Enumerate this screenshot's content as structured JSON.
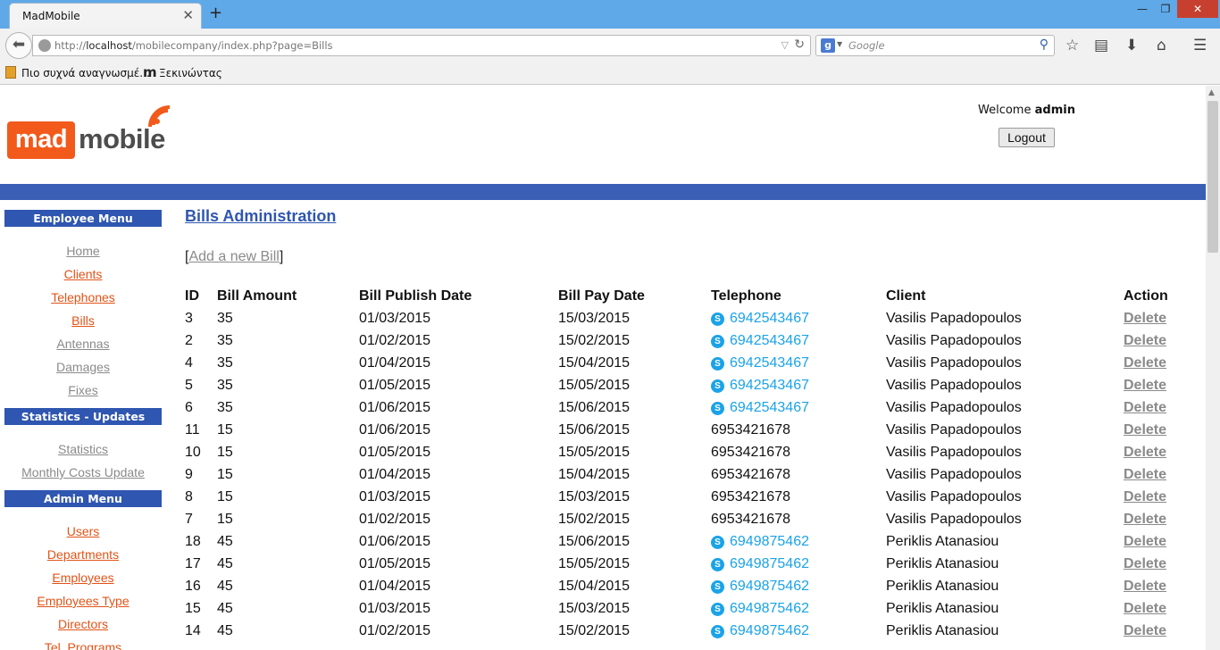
{
  "browser": {
    "tab_title": "MadMobile",
    "tab_close": "✕",
    "new_tab": "+",
    "window_min": "—",
    "window_max": "❐",
    "window_close": "✕",
    "url_prefix": "http://",
    "url_host": "localhost",
    "url_path": "/mobilecompany/index.php?page=Bills",
    "search_placeholder": "Google",
    "bookmark_1": "Πιο συχνά αναγνωσμέ...",
    "bookmark_2": "Ξεκινώντας",
    "bookmark_2_icon": "m"
  },
  "header": {
    "logo_mad": "mad",
    "logo_mobile": "mobile",
    "welcome_prefix": "Welcome",
    "username": "admin",
    "logout_label": "Logout"
  },
  "sidebar": {
    "employee_menu_title": "Employee Menu",
    "employee_items": [
      "Home",
      "Clients",
      "Telephones",
      "Bills",
      "Antennas",
      "Damages",
      "Fixes"
    ],
    "stats_menu_title": "Statistics - Updates",
    "stats_items": [
      "Statistics",
      "Monthly Costs Update"
    ],
    "admin_menu_title": "Admin Menu",
    "admin_items": [
      "Users",
      "Departments",
      "Employees",
      "Employees Type",
      "Directors",
      "Tel. Programs"
    ]
  },
  "main": {
    "title": "Bills Administration",
    "add_link": "Add a new Bill",
    "add_open": "[",
    "add_close": "]",
    "columns": [
      "ID",
      "Bill Amount",
      "Bill Publish Date",
      "Bill Pay Date",
      "Telephone",
      "Client",
      "Action"
    ],
    "action_label": "Delete",
    "rows": [
      {
        "id": "3",
        "amount": "35",
        "publish": "01/03/2015",
        "pay": "15/03/2015",
        "tel": "6942543467",
        "skype": true,
        "client": "Vasilis Papadopoulos"
      },
      {
        "id": "2",
        "amount": "35",
        "publish": "01/02/2015",
        "pay": "15/02/2015",
        "tel": "6942543467",
        "skype": true,
        "client": "Vasilis Papadopoulos"
      },
      {
        "id": "4",
        "amount": "35",
        "publish": "01/04/2015",
        "pay": "15/04/2015",
        "tel": "6942543467",
        "skype": true,
        "client": "Vasilis Papadopoulos"
      },
      {
        "id": "5",
        "amount": "35",
        "publish": "01/05/2015",
        "pay": "15/05/2015",
        "tel": "6942543467",
        "skype": true,
        "client": "Vasilis Papadopoulos"
      },
      {
        "id": "6",
        "amount": "35",
        "publish": "01/06/2015",
        "pay": "15/06/2015",
        "tel": "6942543467",
        "skype": true,
        "client": "Vasilis Papadopoulos"
      },
      {
        "id": "11",
        "amount": "15",
        "publish": "01/06/2015",
        "pay": "15/06/2015",
        "tel": "6953421678",
        "skype": false,
        "client": "Vasilis Papadopoulos"
      },
      {
        "id": "10",
        "amount": "15",
        "publish": "01/05/2015",
        "pay": "15/05/2015",
        "tel": "6953421678",
        "skype": false,
        "client": "Vasilis Papadopoulos"
      },
      {
        "id": "9",
        "amount": "15",
        "publish": "01/04/2015",
        "pay": "15/04/2015",
        "tel": "6953421678",
        "skype": false,
        "client": "Vasilis Papadopoulos"
      },
      {
        "id": "8",
        "amount": "15",
        "publish": "01/03/2015",
        "pay": "15/03/2015",
        "tel": "6953421678",
        "skype": false,
        "client": "Vasilis Papadopoulos"
      },
      {
        "id": "7",
        "amount": "15",
        "publish": "01/02/2015",
        "pay": "15/02/2015",
        "tel": "6953421678",
        "skype": false,
        "client": "Vasilis Papadopoulos"
      },
      {
        "id": "18",
        "amount": "45",
        "publish": "01/06/2015",
        "pay": "15/06/2015",
        "tel": "6949875462",
        "skype": true,
        "client": "Periklis Atanasiou"
      },
      {
        "id": "17",
        "amount": "45",
        "publish": "01/05/2015",
        "pay": "15/05/2015",
        "tel": "6949875462",
        "skype": true,
        "client": "Periklis Atanasiou"
      },
      {
        "id": "16",
        "amount": "45",
        "publish": "01/04/2015",
        "pay": "15/04/2015",
        "tel": "6949875462",
        "skype": true,
        "client": "Periklis Atanasiou"
      },
      {
        "id": "15",
        "amount": "45",
        "publish": "01/03/2015",
        "pay": "15/03/2015",
        "tel": "6949875462",
        "skype": true,
        "client": "Periklis Atanasiou"
      },
      {
        "id": "14",
        "amount": "45",
        "publish": "01/02/2015",
        "pay": "15/02/2015",
        "tel": "6949875462",
        "skype": true,
        "client": "Periklis Atanasiou"
      }
    ]
  },
  "colors": {
    "brand_orange": "#f25a1c",
    "menu_blue": "#2f56b0",
    "skype_blue": "#1aa3e8"
  }
}
